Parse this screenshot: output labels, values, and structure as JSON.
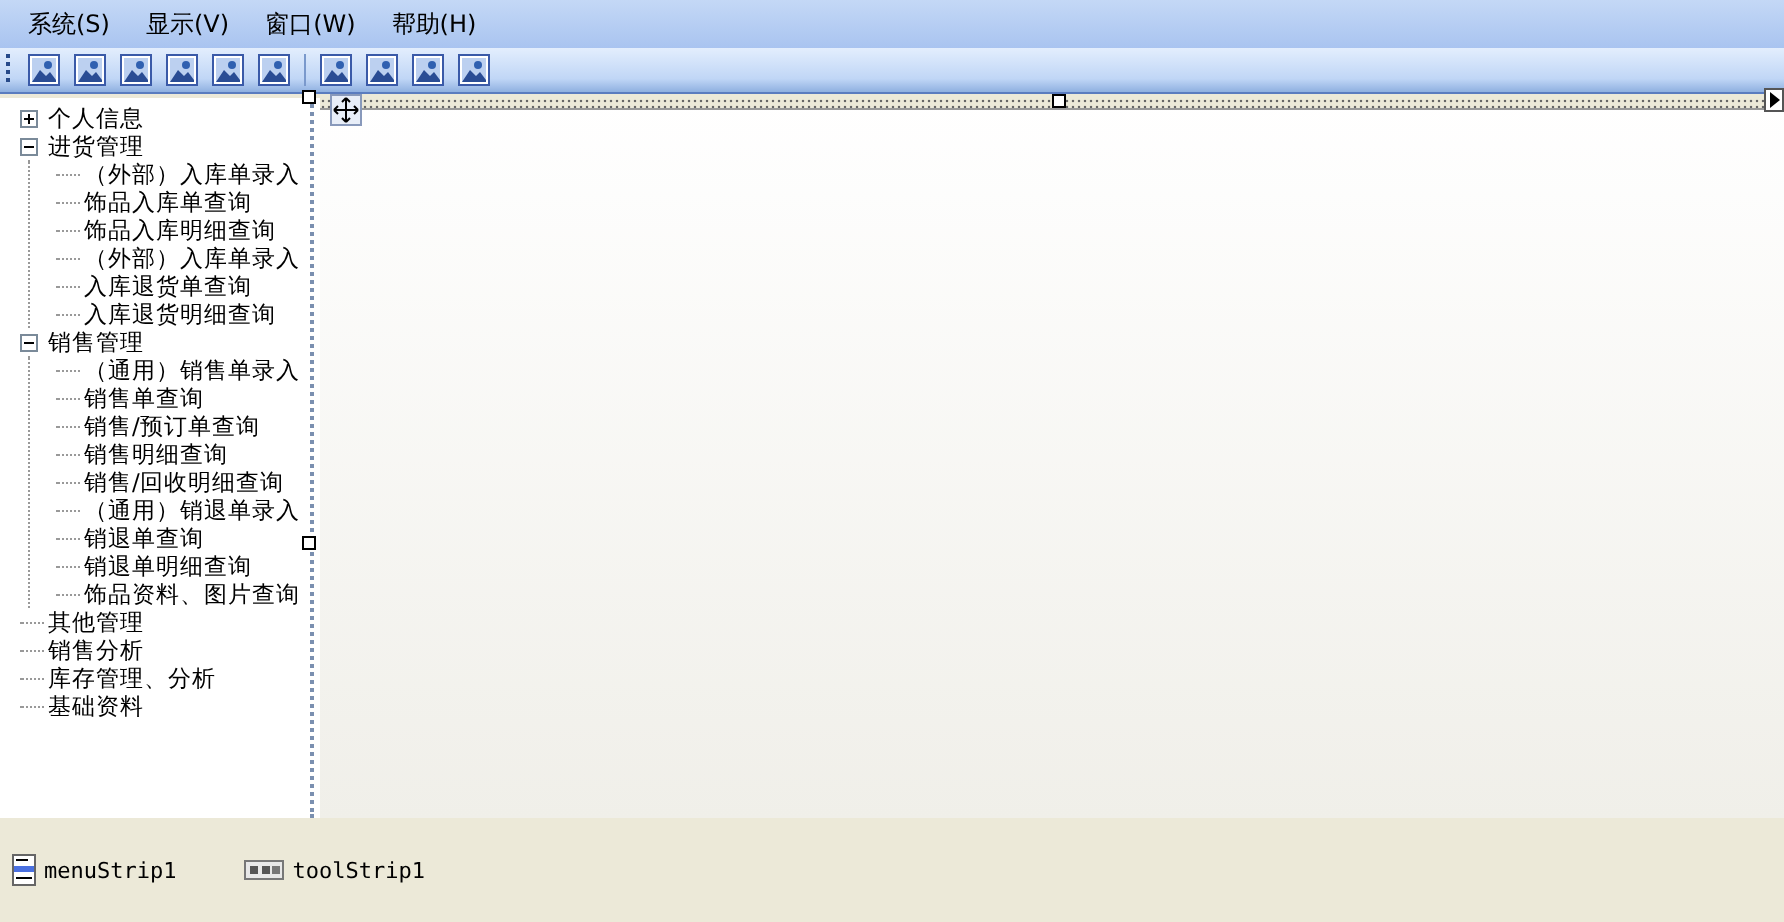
{
  "menu": [
    "系统(S)",
    "显示(V)",
    "窗口(W)",
    "帮助(H)"
  ],
  "toolbar": [
    {
      "kind": "button"
    },
    {
      "kind": "button"
    },
    {
      "kind": "button"
    },
    {
      "kind": "button"
    },
    {
      "kind": "button"
    },
    {
      "kind": "button"
    },
    {
      "kind": "separator"
    },
    {
      "kind": "button"
    },
    {
      "kind": "button"
    },
    {
      "kind": "button"
    },
    {
      "kind": "button"
    }
  ],
  "tree": [
    {
      "label": "个人信息",
      "expanded": false
    },
    {
      "label": "进货管理",
      "expanded": true,
      "children": [
        {
          "label": "（外部）入库单录入"
        },
        {
          "label": "饰品入库单查询"
        },
        {
          "label": "饰品入库明细查询"
        },
        {
          "label": "（外部）入库单录入"
        },
        {
          "label": "入库退货单查询"
        },
        {
          "label": "入库退货明细查询"
        }
      ]
    },
    {
      "label": "销售管理",
      "expanded": true,
      "children": [
        {
          "label": "（通用）销售单录入"
        },
        {
          "label": "销售单查询"
        },
        {
          "label": "销售/预订单查询"
        },
        {
          "label": "销售明细查询"
        },
        {
          "label": "销售/回收明细查询"
        },
        {
          "label": "（通用）销退单录入"
        },
        {
          "label": "销退单查询"
        },
        {
          "label": "销退单明细查询"
        },
        {
          "label": "饰品资料、图片查询"
        }
      ]
    },
    {
      "label": "其他管理"
    },
    {
      "label": "销售分析"
    },
    {
      "label": "库存管理、分析"
    },
    {
      "label": "基础资料"
    }
  ],
  "tray": [
    {
      "kind": "menu",
      "label": "menuStrip1"
    },
    {
      "kind": "tool",
      "label": "toolStrip1"
    }
  ]
}
